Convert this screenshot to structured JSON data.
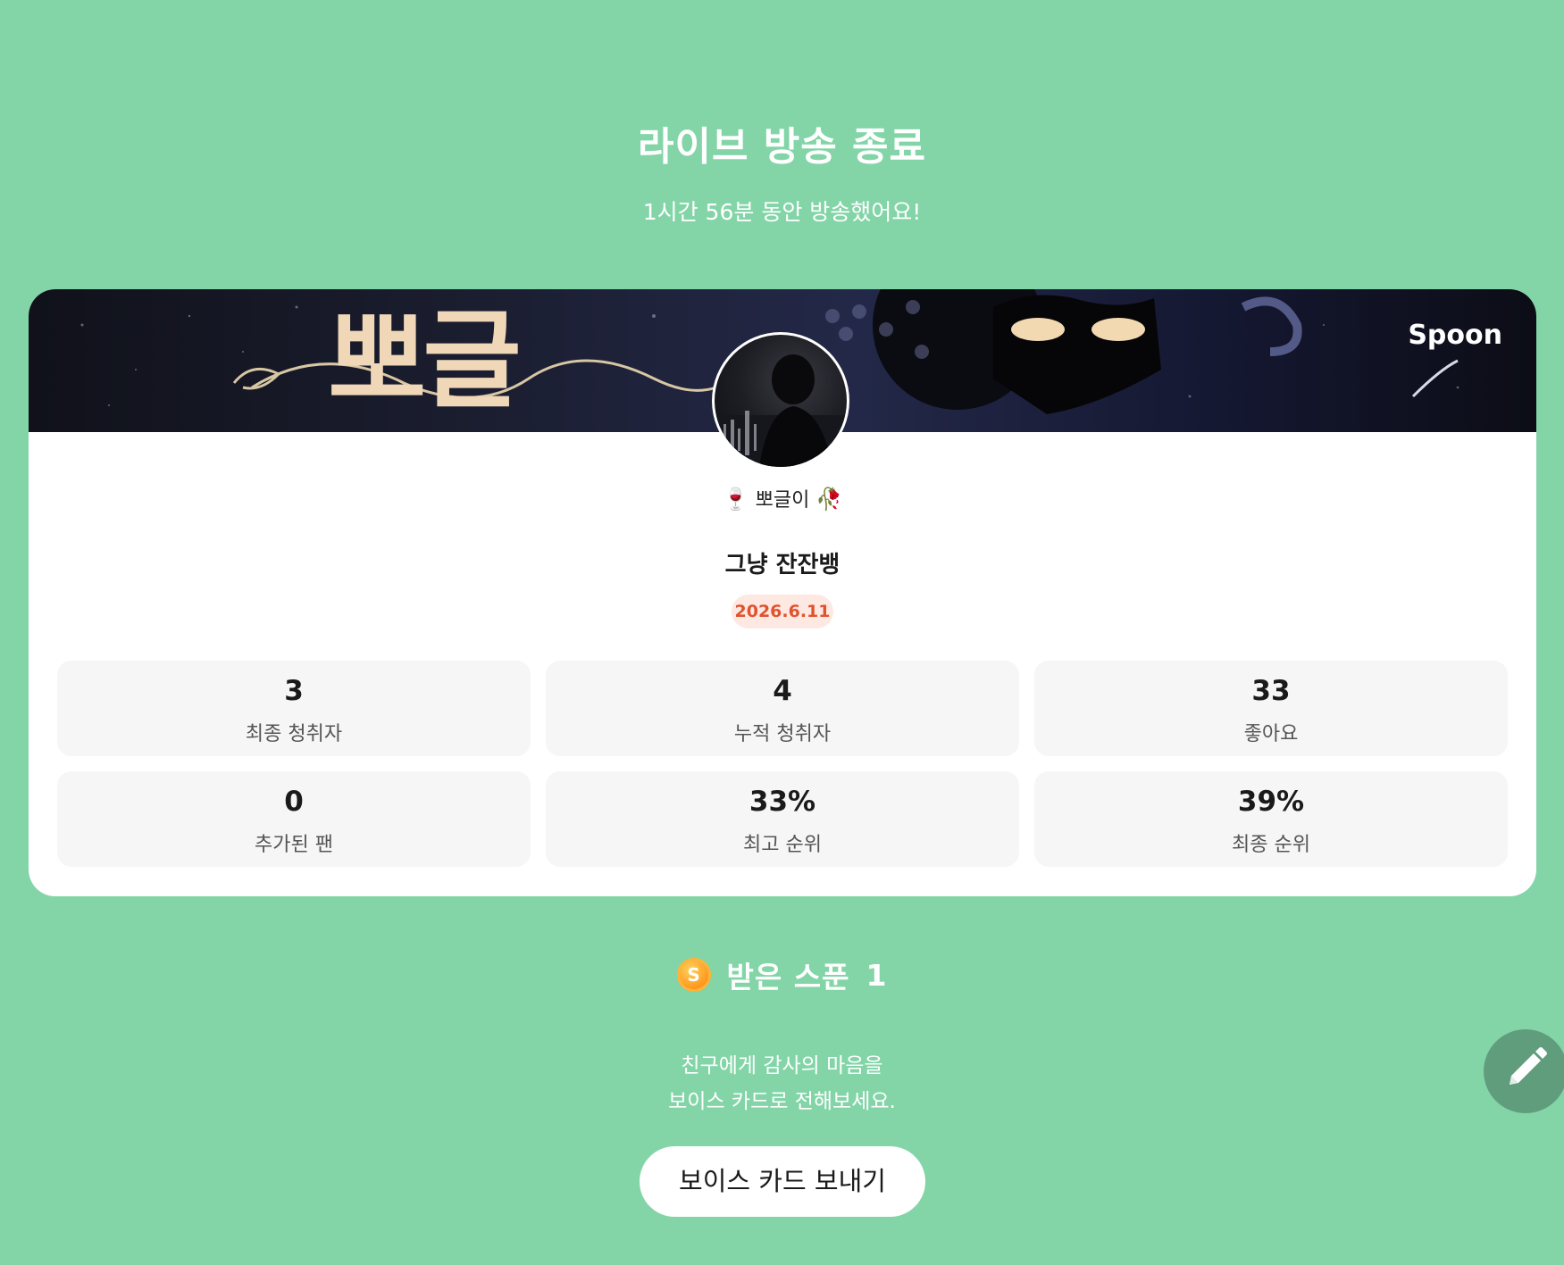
{
  "header": {
    "title": "라이브 방송 종료",
    "subtitle": "1시간 56분 동안 방송했어요!"
  },
  "card": {
    "banner_text": "뽀글",
    "brand": "Spoon",
    "host": {
      "emoji_left": "🍷",
      "name": "뽀글이",
      "emoji_right": "🥀"
    },
    "room_title": "그냥 잔잔뱅",
    "date": "2026.6.11",
    "stats": [
      {
        "value": "3",
        "label": "최종 청취자"
      },
      {
        "value": "4",
        "label": "누적 청취자"
      },
      {
        "value": "33",
        "label": "좋아요"
      },
      {
        "value": "0",
        "label": "추가된 팬"
      },
      {
        "value": "33%",
        "label": "최고 순위"
      },
      {
        "value": "39%",
        "label": "최종 순위"
      }
    ]
  },
  "spoons": {
    "coin_letter": "S",
    "label": "받은 스푼",
    "count": "1"
  },
  "thanks": {
    "line1": "친구에게 감사의 마음을",
    "line2": "보이스 카드로 전해보세요."
  },
  "send_button": "보이스 카드 보내기",
  "icons": {
    "coin": "spoon-coin-icon",
    "fab": "pencil-icon"
  },
  "colors": {
    "background": "#83d5a8",
    "date_badge_bg": "#fde8e2",
    "date_badge_text": "#e0532f",
    "fab": "#5f9d7c",
    "coin": "#ff9a1f"
  }
}
